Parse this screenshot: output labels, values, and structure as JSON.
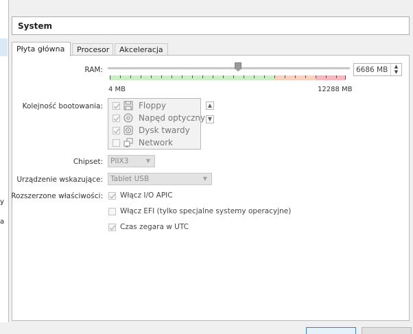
{
  "section_title": "System",
  "left_fragments": [
    "y",
    "a"
  ],
  "tabs": [
    {
      "label": "Płyta główna",
      "active": true
    },
    {
      "label": "Procesor",
      "active": false
    },
    {
      "label": "Akceleracja",
      "active": false
    }
  ],
  "ram": {
    "label": "RAM:",
    "value": "6686 MB",
    "min_label": "4 MB",
    "max_label": "12288 MB",
    "slider_fraction": 0.544
  },
  "boot_order": {
    "label": "Kolejność bootowania:",
    "items": [
      {
        "label": "Floppy",
        "checked": true,
        "icon": "floppy-icon"
      },
      {
        "label": "Napęd optyczny",
        "checked": true,
        "icon": "optical-drive-icon"
      },
      {
        "label": "Dysk twardy",
        "checked": true,
        "icon": "hard-disk-icon"
      },
      {
        "label": "Network",
        "checked": false,
        "icon": "network-icon"
      }
    ]
  },
  "chipset": {
    "label": "Chipset:",
    "value": "PIIX3"
  },
  "pointing_device": {
    "label": "Urządzenie wskazujące:",
    "value": "Tablet USB"
  },
  "extended": {
    "label": "Rozszerzone właściwości:",
    "options": [
      {
        "label": "Włącz I/O APIC",
        "checked": true
      },
      {
        "label": "Włącz EFI (tylko specjalne systemy operacyjne)",
        "checked": false
      },
      {
        "label": "Czas zegara w UTC",
        "checked": true
      }
    ]
  }
}
